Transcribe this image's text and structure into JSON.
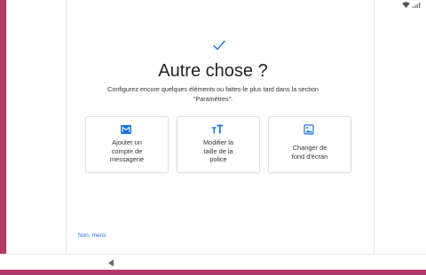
{
  "status_bar": {
    "icons": [
      "wifi-icon",
      "cellular-signal-icon"
    ]
  },
  "setup": {
    "check_icon": "check-icon",
    "title": "Autre chose ?",
    "subtitle": "Configurez encore quelques éléments ou faites-le plus tard dans la section \"Paramètres\".",
    "options": [
      {
        "icon": "mail-icon",
        "label": "Ajouter un\ncompte de\nmessagerie"
      },
      {
        "icon": "text-size-icon",
        "label": "Modifier la\ntaille de la\npolice"
      },
      {
        "icon": "wallpaper-icon",
        "label": "Changer de\nfond d'écran"
      }
    ],
    "skip_label": "Non, merci"
  },
  "nav": {
    "icons": [
      "back-icon"
    ]
  },
  "colors": {
    "accent": "#1a73e8",
    "frame": "#b03a68"
  }
}
